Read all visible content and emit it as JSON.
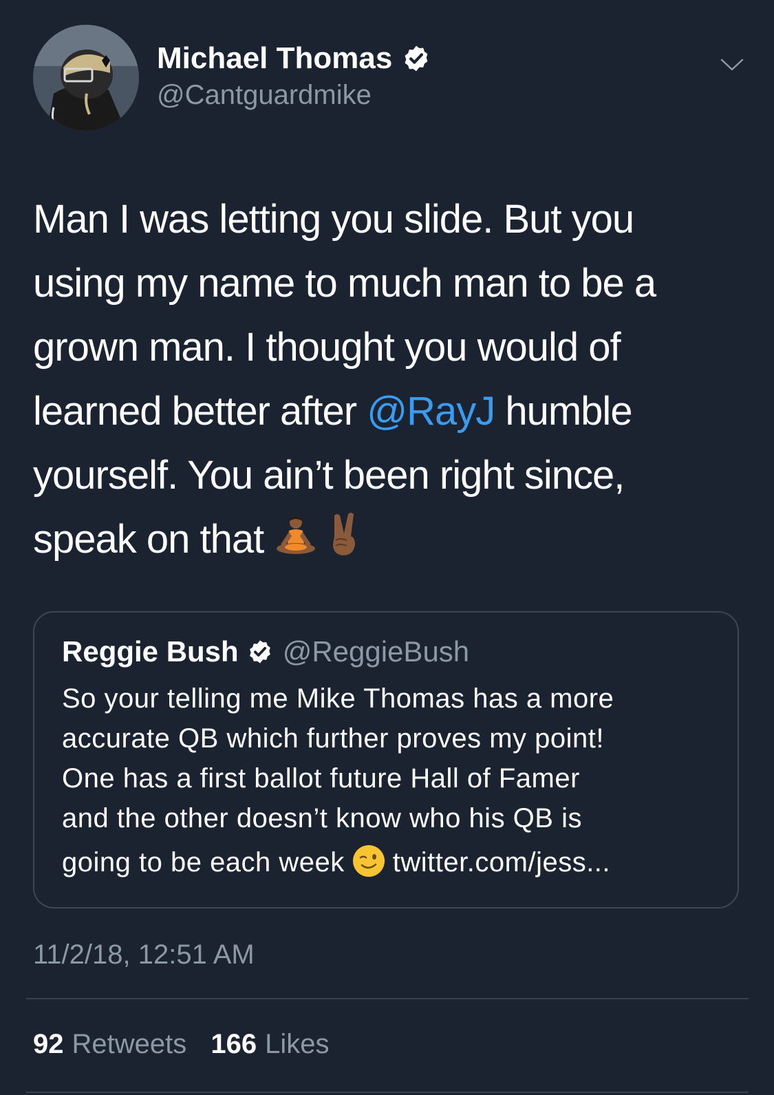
{
  "colors": {
    "background": "#1b2330",
    "text_primary": "#ffffff",
    "text_secondary": "#8b98a5",
    "link": "#3a9cf0",
    "border": "#3c4756"
  },
  "author": {
    "display_name": "Michael Thomas",
    "handle": "@Cantguardmike",
    "verified": true
  },
  "tweet": {
    "line1": "Man I was letting you slide. But you",
    "line2": "using my name to much man to be a",
    "line3": "grown man. I thought you would of",
    "line4_before": "learned better after ",
    "mention": "@RayJ",
    "line4_after": " humble",
    "line5": "yourself. You ain’t been right since,",
    "line6": "speak on that ",
    "emojis": [
      "person-in-lotus-position-emoji",
      "victory-hand-emoji"
    ]
  },
  "quoted_tweet": {
    "display_name": "Reggie Bush",
    "handle": "@ReggieBush",
    "verified": true,
    "line1": "So your telling me Mike Thomas has a more",
    "line2": "accurate QB which further proves my point!",
    "line3": "One has a first ballot future Hall of Famer",
    "line4": "and the other doesn’t know who his QB is",
    "line5_before": "going to be each week",
    "emoji": "winking-face-emoji",
    "link": "twitter.com/jess..."
  },
  "timestamp": "11/2/18, 12:51 AM",
  "stats": {
    "retweets_count": "92",
    "retweets_label": "Retweets",
    "likes_count": "166",
    "likes_label": "Likes"
  }
}
